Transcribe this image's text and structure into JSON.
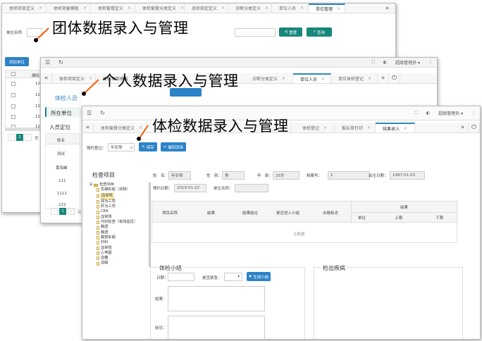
{
  "annotations": {
    "group": "团体数据录入与管理",
    "personal": "个人数据录入与管理",
    "checkup": "体检数据录入与管理"
  },
  "window1": {
    "tabs": [
      "体检项目定义",
      "体检项套模板",
      "体检套餐定义",
      "体检套餐分类定义",
      "总检指定定义",
      "诊断分类定义",
      "单位人员",
      "单位管理"
    ],
    "more": "»",
    "filter_label": "单位名称",
    "reset_label": "重置",
    "search_label": "查询",
    "add_button": "添加单位",
    "col_header": "编码",
    "rows": [
      "12",
      "12",
      "12",
      "12",
      "12"
    ],
    "page": "1",
    "page_prefix": "第"
  },
  "window2": {
    "tabs": [
      "体检项目定义",
      "体检项套模板",
      "诊断分类定义",
      "单位人员",
      "单位体检登记"
    ],
    "more": "»",
    "user": "超级管理员 ▾",
    "side_title": "体检人员",
    "side_items": [
      "所在单位",
      "人员定位"
    ],
    "col_header": "姓名",
    "names": [
      "测试",
      "黄海峰",
      "111",
      "1111",
      "222"
    ],
    "page": "1",
    "page_prefix": "到"
  },
  "window3": {
    "tabs": [
      "体检套餐分类定义",
      "体检登记",
      "报告单打印",
      "结果录入"
    ],
    "more": "»",
    "user": "超级管理员 ▾",
    "register_label": "预约登记：",
    "register_value": "年安琴",
    "save_label": "保存",
    "cancel_label": "撤回消审",
    "tree_title": "检查项目",
    "tree_root": "检查项目",
    "tree_items": [
      "乳腺彩超（双侧）",
      "血常规",
      "肾功三项",
      "肝功三项",
      "CEA",
      "血常规",
      "内科检查（有测血压）",
      "胸透",
      "胸透",
      "腹部彩超",
      "妇科",
      "血常规",
      "心电图",
      "血糖",
      "血脂"
    ],
    "patient": {
      "name_label": "姓　名：",
      "name": "年安琴",
      "sex_label": "性　别：",
      "sex": "男",
      "age_label": "年　龄：",
      "age": "25岁",
      "no_label": "档案号：",
      "no": "1",
      "birth_label": "出生日期：",
      "birth": "1997-01-03",
      "appt_label": "预约日期：",
      "appt": "2019-01-22",
      "unit_label": "单位名称：",
      "unit": ""
    },
    "table_headers": [
      "项目名称",
      "结果",
      "结果结论",
      "是否进入小结",
      "合格标志"
    ],
    "result_group": "结果",
    "result_sub": [
      "单位",
      "上限",
      "下限"
    ],
    "no_data": "无数据",
    "summary_title": "体检小结",
    "date_label": "日期：",
    "urgent_label": "是否紧急：",
    "gen_label": "生成小结",
    "result_label": "结果：",
    "conclusion_label": "结论：",
    "disease_title": "检出疾病"
  }
}
